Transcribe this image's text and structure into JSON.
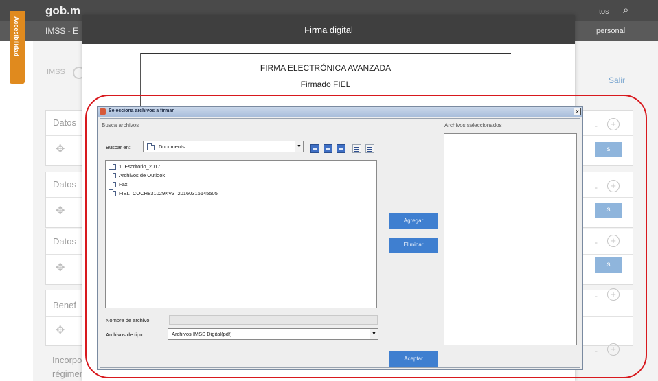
{
  "background": {
    "brand": "gob.m",
    "topbar_right": "tos",
    "subbar_left": "IMSS - E",
    "subbar_right": "personal",
    "accessibility_tab": "Accesibilidad",
    "logo_text": "IMSS",
    "logout_link": "Salir",
    "cards": [
      {
        "title": "Datos"
      },
      {
        "title": "Datos"
      },
      {
        "title": "Datos"
      },
      {
        "title": "Benef"
      }
    ],
    "bottom_line1": "Incorpor",
    "bottom_line2": "régimen obligatorio",
    "side_button_label": "s"
  },
  "modal": {
    "title": "Firma digital",
    "doc_heading": "FIRMA ELECTRÓNICA AVANZADA",
    "doc_subheading": "Firmado FIEL"
  },
  "chooser": {
    "window_title": "Selecciona archivos a firmar",
    "close_glyph": "x",
    "browse_section_label": "Busca archivos",
    "look_in_label": "Buscar en:",
    "look_in_value": "Documents",
    "files": [
      "1. Escritorio_2017",
      "Archivos de Outlook",
      "Fax",
      "FIEL_COCH831029KV3_20160316145505"
    ],
    "file_name_label": "Nombre de archivo:",
    "file_name_value": "",
    "file_type_label": "Archivos de tipo:",
    "file_type_value": "Archivos IMSS Digital(pdf)",
    "selected_files_label": "Archivos seleccionados",
    "add_button": "Agregar",
    "remove_button": "Eliminar",
    "accept_button": "Aceptar"
  },
  "colors": {
    "modal_header": "#3f3f3f",
    "button_blue": "#3f7fd0",
    "highlight_red": "#d8191e",
    "accessibility_orange": "#e08a1e"
  },
  "icons": [
    "search-icon",
    "folder-icon",
    "move-icon",
    "plus-circle-icon",
    "close-icon",
    "up-folder-icon",
    "home-icon",
    "new-folder-icon",
    "list-view-icon",
    "details-view-icon"
  ]
}
